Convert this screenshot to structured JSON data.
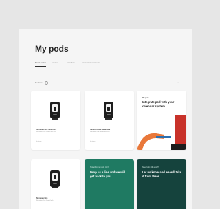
{
  "page": {
    "title": "My pods"
  },
  "tabs": [
    {
      "label": "Smart devices"
    },
    {
      "label": "Services"
    },
    {
      "label": "Calendars"
    },
    {
      "label": "Connected services list"
    }
  ],
  "filter": {
    "label": "Devices"
  },
  "devices": [
    {
      "title": "Sunstore One Smartlock",
      "subtitle": "Sunstore One Smart lock Pro",
      "detail": "In-store"
    },
    {
      "title": "Sunstore One Smartlock",
      "subtitle": "Sunstore One Smart lock Pro",
      "detail": "In-store"
    },
    {
      "title": "Sunstore One",
      "subtitle": "Sunstore One Smart lock",
      "detail": ""
    }
  ],
  "promo": {
    "eyebrow": "My pods",
    "heading": "Integrate pod with your calendar system"
  },
  "help_cards": [
    {
      "eyebrow": "Something not quite right?",
      "heading": "Drop us a line and we will get back to you"
    },
    {
      "eyebrow": "Need help with a pod?",
      "heading": "Let us know and we will take it from there"
    }
  ],
  "colors": {
    "green": "#1f7a62",
    "dark_green": "#15433d",
    "accent_red": "#c8322a",
    "accent_orange": "#e9783a"
  }
}
